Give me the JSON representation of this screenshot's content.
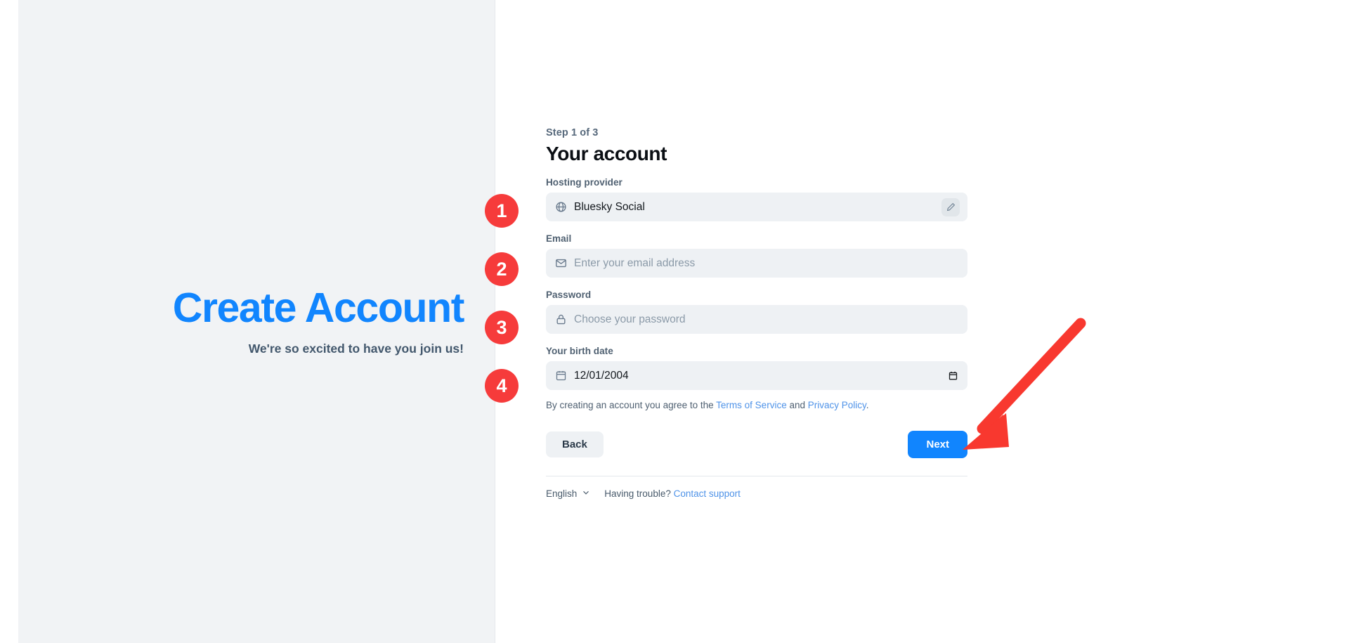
{
  "colors": {
    "brand_blue": "#1185fe",
    "panel_gray": "#f1f3f5",
    "input_gray": "#eef1f4",
    "annotation_red": "#f63b3b",
    "link_blue": "#4f93e8"
  },
  "left": {
    "title": "Create Account",
    "subtitle": "We're so excited to have you join us!"
  },
  "form": {
    "step_label": "Step 1 of 3",
    "step_title": "Your account",
    "fields": [
      {
        "label": "Hosting provider",
        "icon": "globe-icon",
        "value": "Bluesky Social",
        "is_placeholder": false,
        "trailing_icon": "pencil-edit-icon"
      },
      {
        "label": "Email",
        "icon": "envelope-icon",
        "value": "Enter your email address",
        "is_placeholder": true,
        "trailing_icon": ""
      },
      {
        "label": "Password",
        "icon": "lock-icon",
        "value": "Choose your password",
        "is_placeholder": true,
        "trailing_icon": ""
      },
      {
        "label": "Your birth date",
        "icon": "calendar-icon",
        "value": "12/01/2004",
        "is_placeholder": false,
        "trailing_icon": "date-picker-icon"
      }
    ],
    "legal": {
      "prefix": "By creating an account you agree to the ",
      "terms_link": "Terms of Service",
      "middle": " and ",
      "privacy_link": "Privacy Policy",
      "suffix": "."
    },
    "back_label": "Back",
    "next_label": "Next"
  },
  "footer": {
    "language": "English",
    "chevron": "chevron-down-icon",
    "help_text": "Having trouble?",
    "support_link": "Contact support"
  },
  "annotations": {
    "badges": [
      "1",
      "2",
      "3",
      "4"
    ],
    "arrow": "red-arrow-pointing-to-next-button"
  }
}
